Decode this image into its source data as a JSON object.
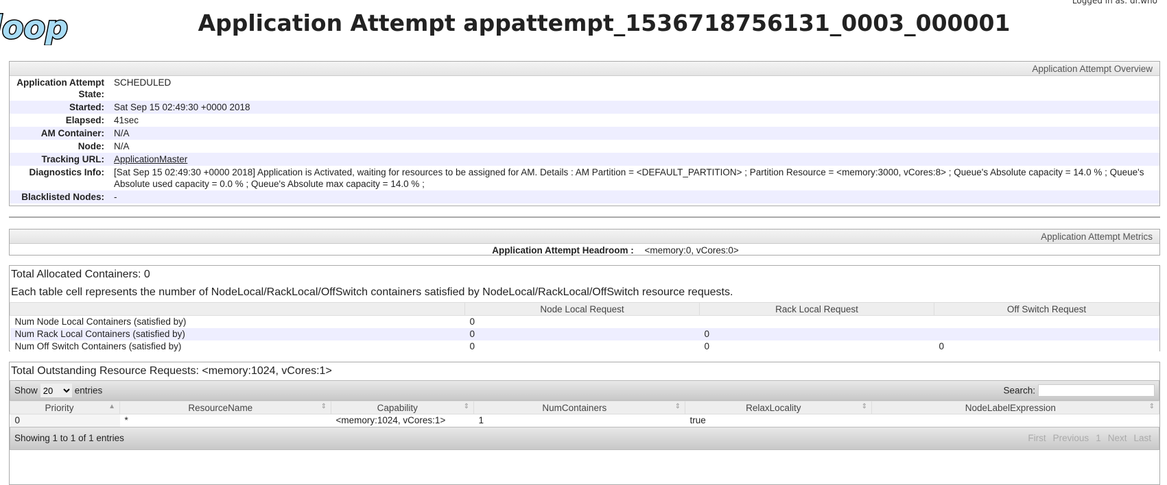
{
  "header": {
    "logo_text": "hadoop",
    "title": "Application Attempt appattempt_1536718756131_0003_000001",
    "logged_in": "Logged in as: dr.who"
  },
  "overview": {
    "heading": "Application Attempt Overview",
    "rows": [
      {
        "label": "Application Attempt State:",
        "value": "SCHEDULED"
      },
      {
        "label": "Started:",
        "value": "Sat Sep 15 02:49:30 +0000 2018"
      },
      {
        "label": "Elapsed:",
        "value": "41sec"
      },
      {
        "label": "AM Container:",
        "value": "N/A"
      },
      {
        "label": "Node:",
        "value": "N/A"
      },
      {
        "label": "Tracking URL:",
        "value": "ApplicationMaster"
      },
      {
        "label": "Diagnostics Info:",
        "value": "[Sat Sep 15 02:49:30 +0000 2018] Application is Activated, waiting for resources to be assigned for AM. Details : AM Partition = <DEFAULT_PARTITION> ; Partition Resource = <memory:3000, vCores:8> ; Queue's Absolute capacity = 14.0 % ; Queue's Absolute used capacity = 0.0 % ; Queue's Absolute max capacity = 14.0 % ;"
      },
      {
        "label": "Blacklisted Nodes:",
        "value": "-"
      }
    ]
  },
  "metrics": {
    "heading": "Application Attempt Metrics",
    "headroom_label": "Application Attempt Headroom :",
    "headroom_value": "<memory:0, vCores:0>"
  },
  "containers": {
    "total": "Total Allocated Containers: 0",
    "desc": "Each table cell represents the number of NodeLocal/RackLocal/OffSwitch containers satisfied by NodeLocal/RackLocal/OffSwitch resource requests.",
    "columns": [
      "",
      "Node Local Request",
      "Rack Local Request",
      "Off Switch Request"
    ],
    "rows": [
      [
        "Num Node Local Containers (satisfied by)",
        "0",
        "",
        ""
      ],
      [
        "Num Rack Local Containers (satisfied by)",
        "0",
        "0",
        ""
      ],
      [
        "Num Off Switch Containers (satisfied by)",
        "0",
        "0",
        "0"
      ]
    ]
  },
  "requests": {
    "total": "Total Outstanding Resource Requests: <memory:1024, vCores:1>",
    "show": "Show",
    "entries_value": "20",
    "entries": "entries",
    "search": "Search:",
    "columns": [
      "Priority",
      "ResourceName",
      "Capability",
      "NumContainers",
      "RelaxLocality",
      "NodeLabelExpression"
    ],
    "rows": [
      [
        "0",
        "*",
        "<memory:1024, vCores:1>",
        "1",
        "true",
        ""
      ]
    ],
    "info": "Showing 1 to 1 of 1 entries",
    "pager": [
      "First",
      "Previous",
      "1",
      "Next",
      "Last"
    ]
  }
}
